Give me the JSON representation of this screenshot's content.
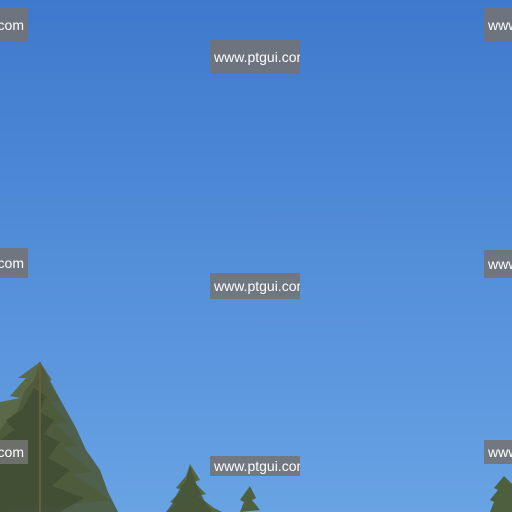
{
  "scene": {
    "description_free": true,
    "sky_colors": [
      "#3f79cd",
      "#5590da",
      "#68a3e3"
    ],
    "foliage_color": "#4c5a3c"
  },
  "watermarks": {
    "center_top": "www.ptgui.com",
    "center_mid": "www.ptgui.com",
    "center_bottom": "www.ptgui.com",
    "left_top": "com",
    "left_mid": "com",
    "left_bottom": "com",
    "right_top": "www",
    "right_mid": "www",
    "right_bottom": "www"
  }
}
